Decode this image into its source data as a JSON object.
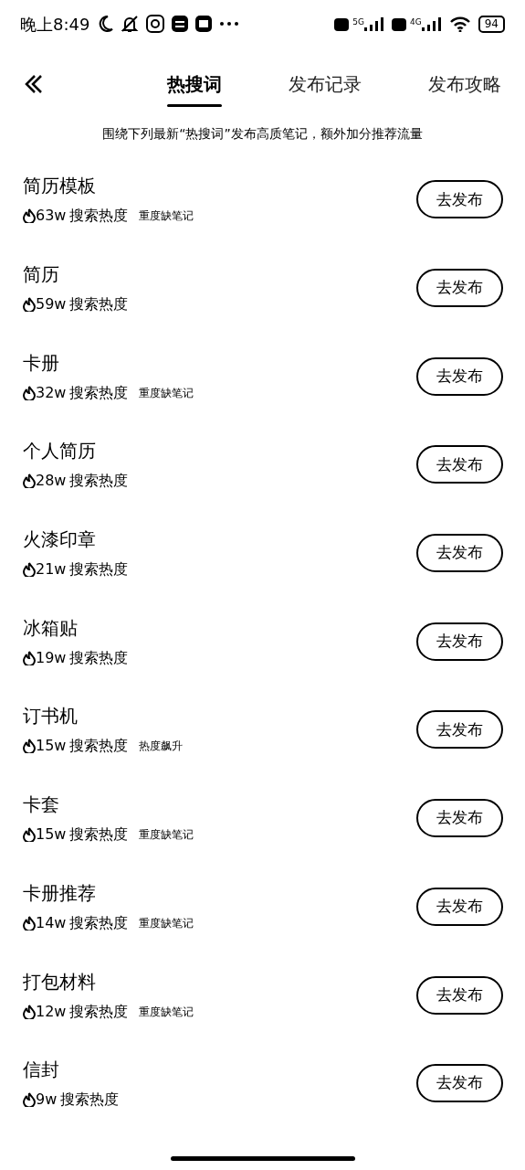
{
  "status_bar": {
    "time": "晚上8:49",
    "battery": "94",
    "network_1": "5G",
    "network_2": "4G"
  },
  "tabs": [
    {
      "label": "热搜词",
      "selected": true
    },
    {
      "label": "发布记录",
      "selected": false
    },
    {
      "label": "发布攻略",
      "selected": false
    }
  ],
  "banner": "围绕下列最新“热搜词”发布高质笔记，额外加分推荐流量",
  "keywords": [
    {
      "title": "简历模板",
      "heat": "63w",
      "heat_label": "搜索热度",
      "tag": "重度缺笔记",
      "button": "去发布"
    },
    {
      "title": "简历",
      "heat": "59w",
      "heat_label": "搜索热度",
      "button": "去发布"
    },
    {
      "title": "卡册",
      "heat": "32w",
      "heat_label": "搜索热度",
      "tag": "重度缺笔记",
      "button": "去发布"
    },
    {
      "title": "个人简历",
      "heat": "28w",
      "heat_label": "搜索热度",
      "button": "去发布"
    },
    {
      "title": "火漆印章",
      "heat": "21w",
      "heat_label": "搜索热度",
      "button": "去发布"
    },
    {
      "title": "冰箱贴",
      "heat": "19w",
      "heat_label": "搜索热度",
      "button": "去发布"
    },
    {
      "title": "订书机",
      "heat": "15w",
      "heat_label": "搜索热度",
      "tag": "热度飙升",
      "button": "去发布"
    },
    {
      "title": "卡套",
      "heat": "15w",
      "heat_label": "搜索热度",
      "tag": "重度缺笔记",
      "button": "去发布"
    },
    {
      "title": "卡册推荐",
      "heat": "14w",
      "heat_label": "搜索热度",
      "tag": "重度缺笔记",
      "button": "去发布"
    },
    {
      "title": "打包材料",
      "heat": "12w",
      "heat_label": "搜索热度",
      "tag": "重度缺笔记",
      "button": "去发布"
    },
    {
      "title": "信封",
      "heat": "9w",
      "heat_label": "搜索热度",
      "button": "去发布"
    }
  ]
}
